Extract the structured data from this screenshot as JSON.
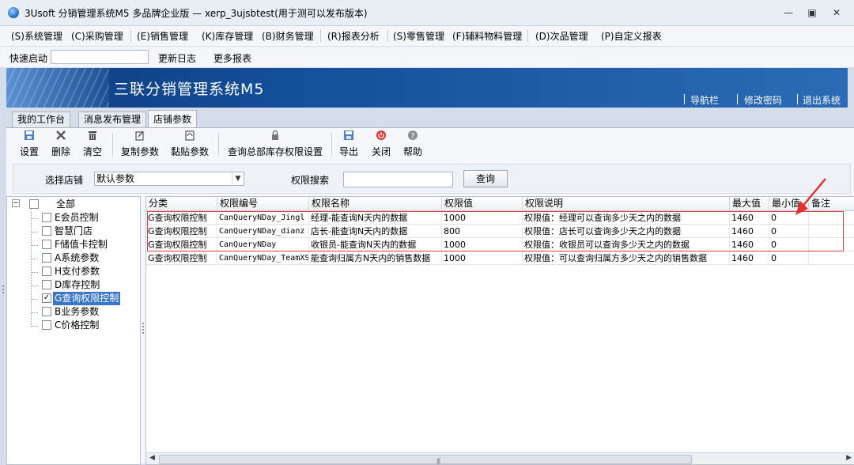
{
  "window": {
    "title": "3Usoft 分销管理系统M5 多品牌企业版 — xerp_3ujsbtest(用于测可以发布版本)"
  },
  "menu": [
    "(S)系统管理",
    "(C)采购管理",
    "(E)销售管理",
    "(K)库存管理",
    "(B)财务管理",
    "(R)报表分析",
    "(S)零售管理",
    "(F)辅料物料管理",
    "(D)次品管理",
    "(P)自定义报表"
  ],
  "quick": {
    "label": "快速启动",
    "input_value": "",
    "links": [
      "更新日志",
      "更多报表"
    ]
  },
  "banner": {
    "title": "三联分销管理系统M5",
    "links": [
      "导航栏",
      "修改密码",
      "退出系统"
    ]
  },
  "tabs": [
    "我的工作台",
    "消息发布管理",
    "店铺参数"
  ],
  "toolbar": [
    {
      "label": "设置",
      "icon": "save-icon"
    },
    {
      "label": "删除",
      "icon": "delete-icon"
    },
    {
      "label": "清空",
      "icon": "trash-icon"
    },
    {
      "label": "复制参数",
      "icon": "copy-icon"
    },
    {
      "label": "黏贴参数",
      "icon": "paste-icon"
    },
    {
      "label": "查询总部库存权限设置",
      "icon": "lock-icon"
    },
    {
      "label": "导出",
      "icon": "export-icon"
    },
    {
      "label": "关闭",
      "icon": "close-icon"
    },
    {
      "label": "帮助",
      "icon": "help-icon"
    }
  ],
  "filter": {
    "store_label": "选择店铺",
    "store_value": "默认参数",
    "search_label": "权限搜索",
    "search_value": "",
    "query_button": "查询"
  },
  "tree": {
    "root": "全部",
    "items": [
      {
        "label": "E会员控制",
        "checked": false
      },
      {
        "label": "智慧门店",
        "checked": false
      },
      {
        "label": "F储值卡控制",
        "checked": false
      },
      {
        "label": "A系统参数",
        "checked": false
      },
      {
        "label": "H支付参数",
        "checked": false
      },
      {
        "label": "D库存控制",
        "checked": false
      },
      {
        "label": "G查询权限控制",
        "checked": true,
        "selected": true
      },
      {
        "label": "B业务参数",
        "checked": false
      },
      {
        "label": "C价格控制",
        "checked": false
      }
    ]
  },
  "grid": {
    "columns": [
      "分类",
      "权限编号",
      "权限名称",
      "权限值",
      "权限说明",
      "最大值",
      "最小值",
      "备注"
    ],
    "rows": [
      [
        "G查询权限控制",
        "CanQueryNDay_Jingl",
        "经理-能查询N天内的数据",
        "1000",
        "权限值：经理可以查询多少天之内的数据",
        "1460",
        "0",
        ""
      ],
      [
        "G查询权限控制",
        "CanQueryNDay_dianz",
        "店长-能查询N天内的数据",
        "800",
        "权限值：店长可以查询多少天之内的数据",
        "1460",
        "0",
        ""
      ],
      [
        "G查询权限控制",
        "CanQueryNDay",
        "收银员-能查询N天内的数据",
        "1000",
        "权限值：收银员可以查询多少天之内的数据",
        "1460",
        "0",
        ""
      ],
      [
        "G查询权限控制",
        "CanQueryNDay_TeamXS",
        "能查询归属方N天内的销售数据",
        "1000",
        "权限值：可以查询归属方多少天之内的销售数据",
        "1460",
        "0",
        ""
      ]
    ]
  },
  "colors": {
    "banner": "#15529e",
    "highlight": "#d94040",
    "selection": "#3a76c8"
  }
}
